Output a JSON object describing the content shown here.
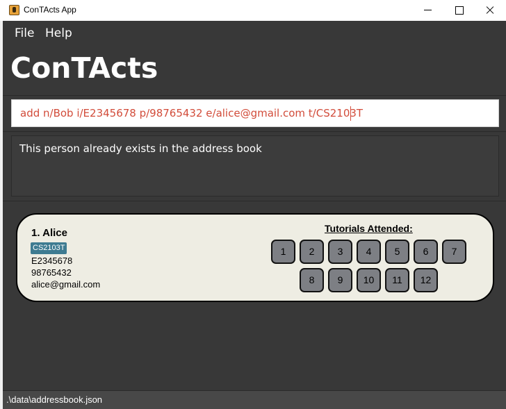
{
  "window": {
    "title": "ConTActs App"
  },
  "menu": {
    "file": "File",
    "help": "Help"
  },
  "app": {
    "heading": "ConTActs"
  },
  "command": {
    "value": "add n/Bob i/E2345678 p/98765432 e/alice@gmail.com t/CS2103T"
  },
  "result": {
    "message": "This person already exists in the address book"
  },
  "persons": [
    {
      "index_name": "1. Alice",
      "tag": "CS2103T",
      "id": "E2345678",
      "phone": "98765432",
      "email": "alice@gmail.com",
      "tutorials_heading": "Tutorials Attended:",
      "tutorials": [
        "1",
        "2",
        "3",
        "4",
        "5",
        "6",
        "7",
        "8",
        "9",
        "10",
        "11",
        "12"
      ]
    }
  ],
  "status": {
    "path": ".\\data\\addressbook.json"
  },
  "colors": {
    "background": "#383838",
    "card": "#eeede3",
    "tag": "#3e7b91",
    "tutorial_button": "#7d7f84",
    "command_text": "#d24c3a"
  }
}
